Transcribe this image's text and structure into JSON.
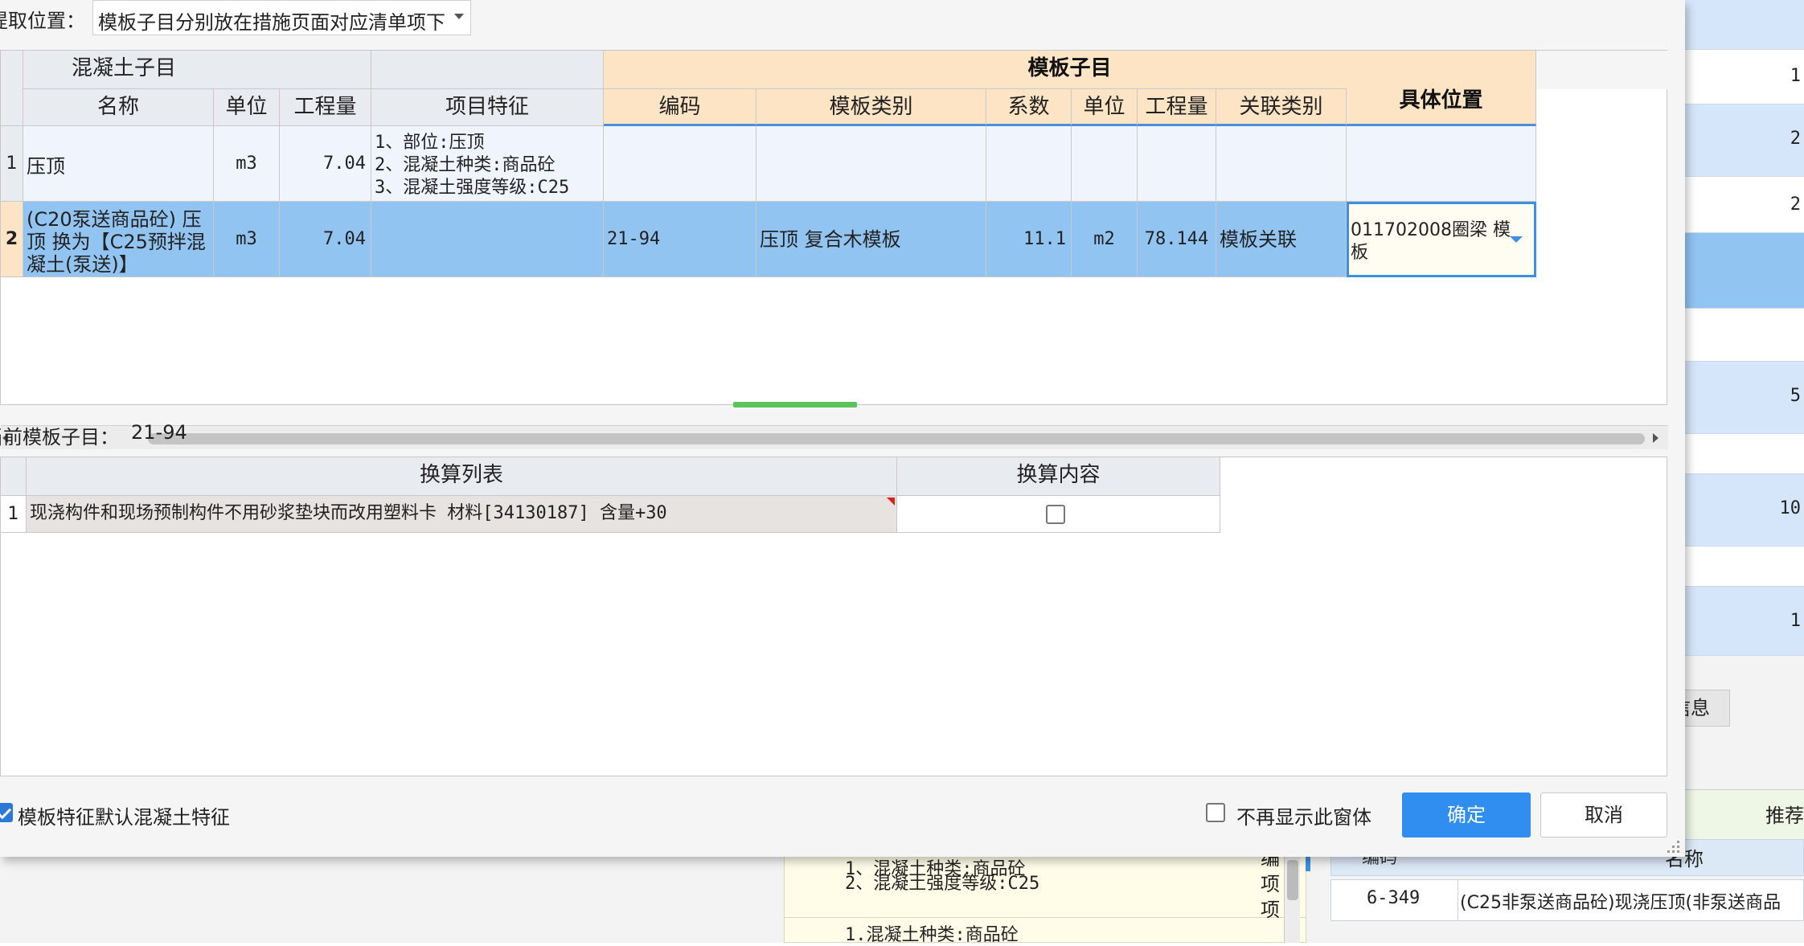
{
  "dialog": {
    "location_label": "提取位置：",
    "location_value": "模板子目分别放在措施页面对应清单项下",
    "concrete_group": "混凝土子目",
    "template_group": "模板子目",
    "grid1_columns": {
      "name": "名称",
      "unit": "单位",
      "qty": "工程量",
      "feature": "项目特征",
      "code": "编码",
      "tpl_type": "模板类别",
      "coef": "系数",
      "t_unit": "单位",
      "t_qty": "工程量",
      "rel_type": "关联类别",
      "position": "具体位置"
    },
    "rows": [
      {
        "num": "1",
        "name": "压顶",
        "unit": "m3",
        "qty": "7.04",
        "feature_lines": [
          "1、部位:压顶",
          "2、混凝土种类:商品砼",
          "3、混凝土强度等级:C25"
        ],
        "code": "",
        "tpl_type": "",
        "coef": "",
        "t_unit": "",
        "t_qty": "",
        "rel_type": "",
        "position": ""
      },
      {
        "num": "2",
        "name_lines": [
          "(C20泵送商品砼) 压",
          "顶  换为【C25预拌混",
          "凝土(泵送)】"
        ],
        "unit": "m3",
        "qty": "7.04",
        "code": "21-94",
        "tpl_type": "压顶 复合木模板",
        "coef": "11.1",
        "t_unit": "m2",
        "t_qty": "78.144",
        "rel_type": "模板关联",
        "position_lines": [
          "011702008圈梁 模",
          "板"
        ]
      }
    ],
    "current_label": "当前模板子目：",
    "current_value": "21-94",
    "grid2_columns": {
      "list": "换算列表",
      "content": "换算内容"
    },
    "grid2_rows": [
      {
        "num": "1",
        "text": "现浇构件和现场预制构件不用砂浆垫块而改用塑料卡 材料[34130187] 含量+30",
        "checked": false
      }
    ],
    "default_feature_label": "模板特征默认混凝土特征",
    "default_feature_checked": true,
    "no_show_label": "不再显示此窗体",
    "no_show_checked": false,
    "ok_label": "确定",
    "cancel_label": "取消"
  },
  "background": {
    "right_col_values": [
      "1",
      "2",
      "2",
      "5",
      "10",
      "1"
    ],
    "tab_label": "信息",
    "right_text": "推荐",
    "table_head_code": "编码",
    "table_head_name": "名称",
    "table_row_code": "6-349",
    "table_row_name": "(C25非泵送商品砼)现浇压顶(非泵送商品",
    "feature_lines": [
      "1、混凝土种类:商品砼",
      "2、混凝土强度等级:C25",
      "1.混凝土种类:商品砼"
    ],
    "vertical_text": [
      "编",
      "项",
      "项"
    ]
  },
  "colors": {
    "selected_row": "#92c4f1",
    "orange_header": "#fde4c4",
    "primary_button": "#2f8ef0"
  }
}
